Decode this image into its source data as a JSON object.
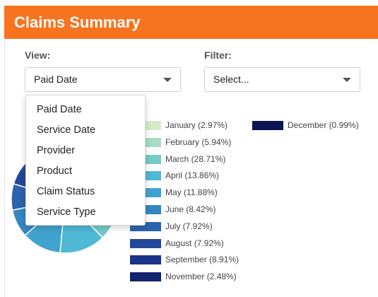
{
  "header": {
    "title": "Claims Summary"
  },
  "view": {
    "label": "View:",
    "selected": "Paid Date"
  },
  "filter": {
    "label": "Filter:",
    "placeholder": "Select..."
  },
  "view_menu": {
    "items": [
      "Paid Date",
      "Service Date",
      "Provider",
      "Product",
      "Claim Status",
      "Service Type"
    ]
  },
  "legend": [
    {
      "label": "January (2.97%)",
      "color": "#d6ecc8"
    },
    {
      "label": "February (5.94%)",
      "color": "#a8dcc6"
    },
    {
      "label": "March (28.71%)",
      "color": "#76cbc8"
    },
    {
      "label": "April (13.86%)",
      "color": "#4fb9d6"
    },
    {
      "label": "May (11.88%)",
      "color": "#41a3cf"
    },
    {
      "label": "June (8.42%)",
      "color": "#3686c2"
    },
    {
      "label": "July (7.92%)",
      "color": "#2c63ad"
    },
    {
      "label": "August (7.92%)",
      "color": "#22489a"
    },
    {
      "label": "September (8.91%)",
      "color": "#1b338a"
    },
    {
      "label": "November (2.48%)",
      "color": "#13246f"
    },
    {
      "label": "December (0.99%)",
      "color": "#0b1655"
    }
  ],
  "chart_data": {
    "type": "pie",
    "categories": [
      "January",
      "February",
      "March",
      "April",
      "May",
      "June",
      "July",
      "August",
      "September",
      "November",
      "December"
    ],
    "values": [
      2.97,
      5.94,
      28.71,
      13.86,
      11.88,
      8.42,
      7.92,
      7.92,
      8.91,
      2.48,
      0.99
    ],
    "legend_position": "right"
  }
}
